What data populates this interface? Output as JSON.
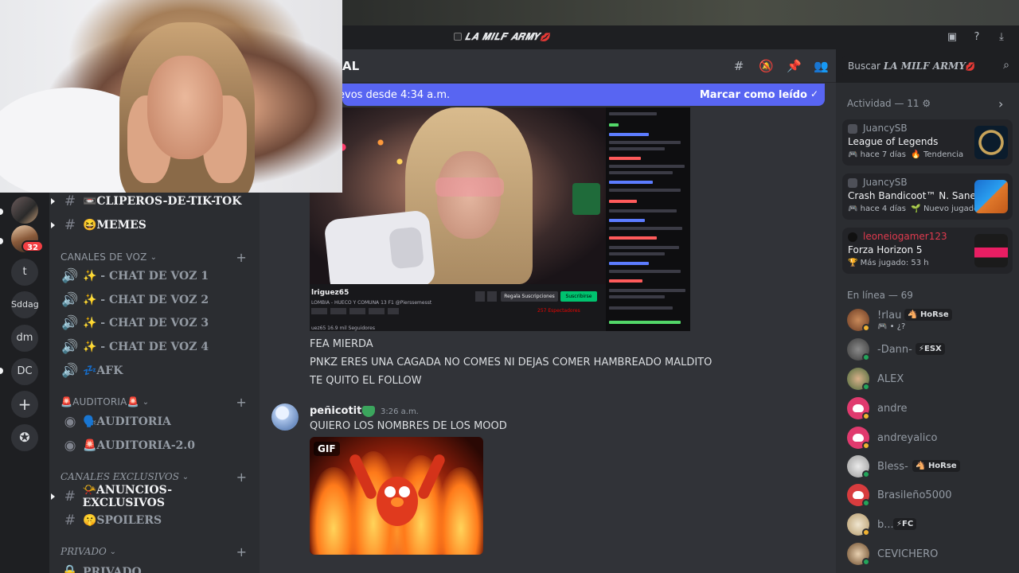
{
  "window": {
    "server_title": "𝑳𝑨 𝑴𝑰𝑳𝑭 𝑨𝑹𝑴𝒀",
    "heart": "💋"
  },
  "header": {
    "channel_name": "AL",
    "icons": [
      "threads-icon",
      "mute-icon",
      "pin-icon",
      "members-icon"
    ]
  },
  "search": {
    "placeholder_prefix": "Buscar",
    "placeholder_server": "𝑳𝑨 𝑴𝑰𝑳𝑭 𝑨𝑹𝑴𝒀",
    "heart": "💋"
  },
  "new_messages_bar": {
    "text": "evos desde 4:34 a.m.",
    "action": "Marcar como leído"
  },
  "rail": {
    "badge": "32",
    "items": [
      "t",
      "Sddag",
      "dm",
      "DC"
    ]
  },
  "sidebar": {
    "channels_top": [
      {
        "name": "📼CLIPEROS-DE-TIK-TOK"
      },
      {
        "name": "😆MEMES"
      }
    ],
    "voice_category": "CANALES DE VOZ",
    "voice_channels": [
      {
        "name": "✨ - CHAT DE VOZ 1"
      },
      {
        "name": "✨ - CHAT DE VOZ 2"
      },
      {
        "name": "✨ - CHAT DE VOZ 3"
      },
      {
        "name": "✨ - CHAT DE VOZ 4"
      },
      {
        "name": "💤AFK"
      }
    ],
    "audit_category": "🚨AUDITORIA🚨",
    "audit_channels": [
      {
        "name": "🗣️AUDITORIA"
      },
      {
        "name": "🚨AUDITORIA-2.0"
      }
    ],
    "exclusive_category": "CANALES EXCLUSIVOS",
    "exclusive_channels": [
      {
        "name": "📯ANUNCIOS-EXCLUSIVOS"
      },
      {
        "name": "🤫SPOILERS"
      }
    ],
    "private_category": "PRIVADO",
    "private_channels": [
      {
        "name": "PRIVADO"
      }
    ]
  },
  "stream": {
    "streamer": "lriguez65",
    "subtitle": "LOMBIA - HUECO Y COMUNA 13 F1 @Pierssemesst",
    "followers": "uez65  16.9 mil Seguidores",
    "gift_label": "Regala Suscripciones",
    "sub_label": "Suscribirse",
    "viewers": "257 Espectadores"
  },
  "messages": {
    "lines": [
      "FEA MIERDA",
      "PNKZ ERES UNA CAGADA NO COMES NI DEJAS COMER HAMBREADO MALDITO",
      "TE QUITO EL FOLLOW"
    ],
    "second": {
      "author": "peñicotito",
      "time": "3:26 a.m.",
      "text": "QUIERO LOS NOMBRES DE LOS MOOD",
      "gif_label": "GIF"
    }
  },
  "activity": {
    "title": "Actividad — 11",
    "cards": [
      {
        "user": "JuancySB",
        "game": "League of Legends",
        "meta1": "hace 7 días",
        "meta2": "Tendencia"
      },
      {
        "user": "JuancySB",
        "game": "Crash Bandicoot™ N. Sane ...",
        "meta1": "hace 4 días",
        "meta2": "Nuevo jugador"
      },
      {
        "user": "leoneiogamer123",
        "game": "Forza Horizon 5",
        "meta1": "Más jugado: 53 h"
      }
    ]
  },
  "members": {
    "title": "En línea — 69",
    "list": [
      {
        "name": "!rlau",
        "tag": "HoRse",
        "sub": "🎮 • ¿?"
      },
      {
        "name": "-Dann-",
        "tag": "⚡ESX"
      },
      {
        "name": "ALEX"
      },
      {
        "name": "andre"
      },
      {
        "name": "andreyalico"
      },
      {
        "name": "Bless-",
        "tag": "HoRse"
      },
      {
        "name": "Brasileño5000"
      },
      {
        "name": "b...",
        "tag": "⚡FC"
      },
      {
        "name": "CEVICHERO"
      }
    ]
  },
  "colors": {
    "accent": "#5865f2",
    "online": "#23a55a",
    "idle": "#f0b232"
  }
}
